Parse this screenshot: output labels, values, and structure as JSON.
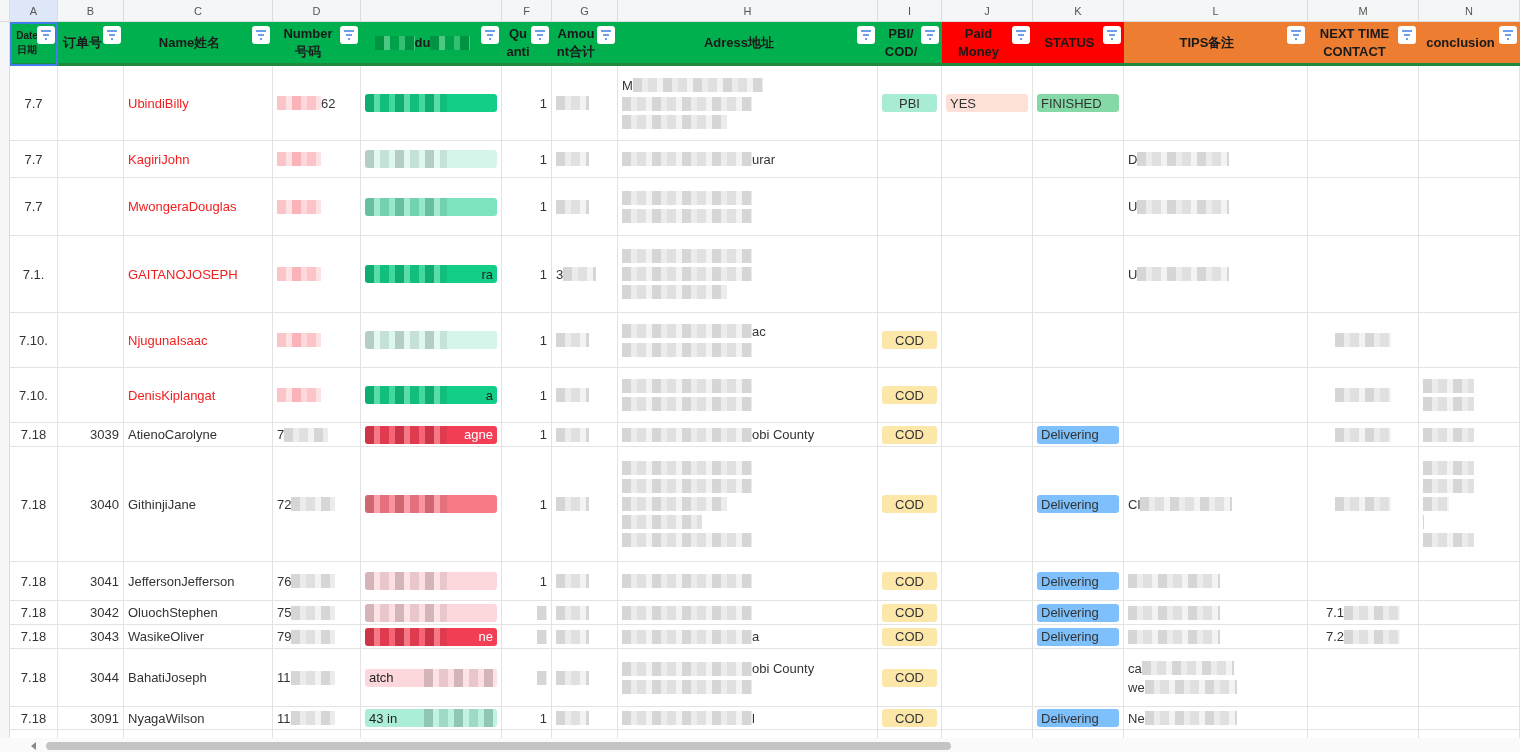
{
  "columns": [
    {
      "letter": "A",
      "header": [
        "Date",
        "日期"
      ],
      "color": "#00b04f",
      "selected": true
    },
    {
      "letter": "B",
      "header": [
        "订单号"
      ],
      "color": "#00b04f",
      "selected": false
    },
    {
      "letter": "C",
      "header": [
        "Name姓名"
      ],
      "color": "#00b04f",
      "selected": false
    },
    {
      "letter": "D",
      "header": [
        "Number",
        "号码"
      ],
      "color": "#00b04f",
      "selected": false
    },
    {
      "header": [
        "du"
      ],
      "redacted": true,
      "color": "#00b04f",
      "selected": false
    },
    {
      "letter": "F",
      "header": [
        "Qu",
        "anti"
      ],
      "color": "#00b04f",
      "selected": false
    },
    {
      "letter": "G",
      "header": [
        "Amou",
        "nt合计"
      ],
      "color": "#00b04f",
      "selected": false
    },
    {
      "letter": "H",
      "header": [
        "Adress地址"
      ],
      "color": "#00b04f",
      "selected": false
    },
    {
      "letter": "I",
      "header": [
        "PBI/",
        "COD/"
      ],
      "color": "#00b04f",
      "selected": false
    },
    {
      "letter": "J",
      "header": [
        "Paid",
        "Money"
      ],
      "color": "#ff0000",
      "selected": false
    },
    {
      "letter": "K",
      "header": [
        "STATUS"
      ],
      "color": "#ff0000",
      "selected": false
    },
    {
      "letter": "L",
      "header": [
        "TIPS备注"
      ],
      "color": "#ed7d31",
      "selected": false
    },
    {
      "letter": "M",
      "header": [
        "NEXT TIME",
        "CONTACT"
      ],
      "color": "#ed7d31",
      "selected": false
    },
    {
      "letter": "N",
      "header": [
        "conclusion"
      ],
      "color": "#ed7d31",
      "selected": false
    }
  ],
  "rows": [
    {
      "date": "7.7",
      "name": "UbindiBilly",
      "flagged": true,
      "number": {
        "redacted": true,
        "kind": "suffix",
        "texts": [
          "62"
        ]
      },
      "product": {
        "redacted": true,
        "color": "#13ce86"
      },
      "quantity": "1",
      "amount": {
        "redacted": true
      },
      "address": {
        "redacted": true,
        "kind": "prefix",
        "texts": [
          "M"
        ]
      },
      "pay": {
        "text": "PBI",
        "color": "#a9ecd4"
      },
      "paid": {
        "text": "YES",
        "color": "#fde0d8"
      },
      "status": {
        "text": "FINISHED",
        "color": "#84d9a7"
      }
    },
    {
      "date": "7.7",
      "name": "KagiriJohn",
      "flagged": true,
      "number": {
        "redacted": true
      },
      "product": {
        "redacted": true,
        "color": "#d6f5ea"
      },
      "quantity": "1",
      "amount": {
        "redacted": true
      },
      "address": {
        "redacted": true,
        "kind": "suffix",
        "texts": [
          "urar"
        ]
      },
      "tips": {
        "redacted": true,
        "kind": "prefix",
        "texts": [
          "D"
        ]
      }
    },
    {
      "date": "7.7",
      "name": "MwongeraDouglas",
      "flagged": true,
      "number": {
        "redacted": true
      },
      "product": {
        "redacted": true,
        "color": "#7ce3bd"
      },
      "quantity": "1",
      "amount": {
        "redacted": true
      },
      "address": {
        "redacted": true
      },
      "tips": {
        "redacted": true,
        "kind": "prefix",
        "texts": [
          "U"
        ]
      }
    },
    {
      "date": "7.1.",
      "name": "GAITANOJOSEPH",
      "flagged": true,
      "number": {
        "redacted": true
      },
      "product": {
        "redacted": true,
        "kind": "suffix",
        "texts": [
          "ra"
        ],
        "color": "#13ce86"
      },
      "quantity": "1",
      "amount": {
        "redacted": true,
        "kind": "prefix",
        "texts": [
          "3"
        ]
      },
      "address": {
        "redacted": true
      },
      "tips": {
        "redacted": true,
        "kind": "prefix",
        "texts": [
          "U"
        ]
      }
    },
    {
      "date": "7.10.",
      "name": "NjugunaIsaac",
      "flagged": true,
      "number": {
        "redacted": true
      },
      "product": {
        "redacted": true,
        "color": "#d6f5ea"
      },
      "quantity": "1",
      "amount": {
        "redacted": true
      },
      "address": {
        "redacted": true,
        "kind": "suffix",
        "texts": [
          "ac"
        ]
      },
      "pay": {
        "text": "COD",
        "color": "#fde7a8"
      },
      "next": {
        "redacted": true
      }
    },
    {
      "date": "7.10.",
      "name": "DenisKiplangat",
      "flagged": true,
      "number": {
        "redacted": true
      },
      "product": {
        "redacted": true,
        "kind": "suffix",
        "texts": [
          "a"
        ],
        "color": "#13ce86"
      },
      "quantity": "1",
      "amount": {
        "redacted": true
      },
      "address": {
        "redacted": true
      },
      "pay": {
        "text": "COD",
        "color": "#fde7a8"
      },
      "next": {
        "redacted": true
      },
      "conclusion": {
        "redacted": true
      }
    },
    {
      "date": "7.18",
      "order": "3039",
      "name": "AtienoCarolyne",
      "flagged": false,
      "number": {
        "redacted": true,
        "kind": "prefix",
        "texts": [
          "7"
        ]
      },
      "product": {
        "redacted": true,
        "kind": "suffix",
        "texts": [
          "agne"
        ],
        "color": "#f23f55"
      },
      "quantity": "1",
      "amount": {
        "redacted": true
      },
      "address": {
        "redacted": true,
        "kind": "suffix",
        "texts": [
          "obi County"
        ]
      },
      "pay": {
        "text": "COD",
        "color": "#fde7a8"
      },
      "status": {
        "text": "Delivering",
        "color": "#7ec0fb"
      },
      "next": {
        "redacted": true
      },
      "conclusion": {
        "redacted": true
      }
    },
    {
      "date": "7.18",
      "order": "3040",
      "name": "GithinjiJane",
      "flagged": false,
      "number": {
        "redacted": true,
        "kind": "prefix",
        "texts": [
          "72"
        ]
      },
      "product": {
        "redacted": true,
        "color": "#f87a86"
      },
      "quantity": "1",
      "amount": {
        "redacted": true
      },
      "address": {
        "redacted": true
      },
      "pay": {
        "text": "COD",
        "color": "#fde7a8"
      },
      "status": {
        "text": "Delivering",
        "color": "#7ec0fb"
      },
      "tips": {
        "redacted": true,
        "kind": "prefix",
        "texts": [
          "Cl"
        ]
      },
      "next": {
        "redacted": true
      },
      "conclusion": {
        "redacted": true
      }
    },
    {
      "date": "7.18",
      "order": "3041",
      "name": "JeffersonJefferson",
      "flagged": false,
      "number": {
        "redacted": true,
        "kind": "prefix",
        "texts": [
          "76"
        ]
      },
      "product": {
        "redacted": true,
        "color": "#fcd7dc"
      },
      "quantity": "1",
      "amount": {
        "redacted": true
      },
      "address": {
        "redacted": true
      },
      "pay": {
        "text": "COD",
        "color": "#fde7a8"
      },
      "status": {
        "text": "Delivering",
        "color": "#7ec0fb"
      },
      "tips": {
        "redacted": true
      }
    },
    {
      "date": "7.18",
      "order": "3042",
      "name": "OluochStephen",
      "flagged": false,
      "number": {
        "redacted": true,
        "kind": "prefix",
        "texts": [
          "75"
        ]
      },
      "product": {
        "redacted": true,
        "color": "#fcd7dc"
      },
      "amount": {
        "redacted": true
      },
      "address": {
        "redacted": true
      },
      "pay": {
        "text": "COD",
        "color": "#fde7a8"
      },
      "status": {
        "text": "Delivering",
        "color": "#7ec0fb"
      },
      "tips": {
        "redacted": true
      },
      "next": {
        "redacted": true,
        "kind": "prefix",
        "texts": [
          "7.1"
        ]
      }
    },
    {
      "date": "7.18",
      "order": "3043",
      "name": "WasikeOliver",
      "flagged": false,
      "number": {
        "redacted": true,
        "kind": "prefix",
        "texts": [
          "79"
        ]
      },
      "product": {
        "redacted": true,
        "kind": "suffix",
        "texts": [
          "ne"
        ],
        "color": "#f23f55"
      },
      "amount": {
        "redacted": true
      },
      "address": {
        "redacted": true,
        "kind": "suffix",
        "texts": [
          "a"
        ]
      },
      "pay": {
        "text": "COD",
        "color": "#fde7a8"
      },
      "status": {
        "text": "Delivering",
        "color": "#7ec0fb"
      },
      "tips": {
        "redacted": true
      },
      "next": {
        "redacted": true,
        "kind": "prefix",
        "texts": [
          "7.2"
        ]
      }
    },
    {
      "date": "7.18",
      "order": "3044",
      "name": "BahatiJoseph",
      "flagged": false,
      "number": {
        "redacted": true,
        "kind": "prefix",
        "texts": [
          "11"
        ]
      },
      "product": {
        "redacted": true,
        "kind": "prefix",
        "texts": [
          "atch"
        ],
        "color": "#fcd7dc"
      },
      "amount": {
        "redacted": true
      },
      "address": {
        "redacted": true,
        "kind": "suffix",
        "texts": [
          "obi County"
        ]
      },
      "pay": {
        "text": "COD",
        "color": "#fde7a8"
      },
      "tips": {
        "redacted": true,
        "kind": "prefix",
        "texts": [
          "ca",
          "we"
        ]
      }
    },
    {
      "date": "7.18",
      "order": "3091",
      "name": "NyagaWilson",
      "flagged": false,
      "number": {
        "redacted": true,
        "kind": "prefix",
        "texts": [
          "11"
        ]
      },
      "product": {
        "redacted": true,
        "kind": "prefix",
        "texts": [
          "43 in"
        ],
        "color": "#abedd6"
      },
      "quantity": "1",
      "amount": {
        "redacted": true
      },
      "address": {
        "redacted": true,
        "kind": "suffix",
        "texts": [
          "l"
        ]
      },
      "pay": {
        "text": "COD",
        "color": "#fde7a8"
      },
      "status": {
        "text": "Delivering",
        "color": "#7ec0fb"
      },
      "tips": {
        "redacted": true,
        "kind": "prefix",
        "texts": [
          "Ne"
        ]
      }
    }
  ]
}
